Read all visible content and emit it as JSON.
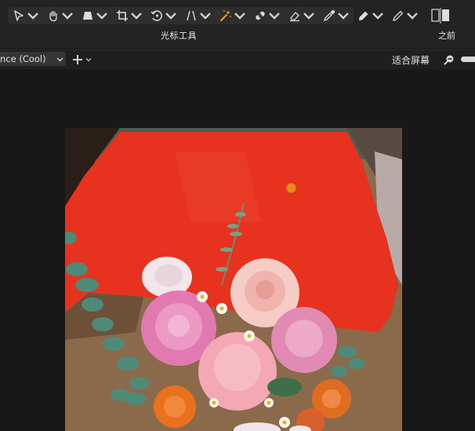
{
  "toolbar": {
    "tools": [
      {
        "icon": "select-arrow-icon",
        "label": ""
      },
      {
        "icon": "hand-icon",
        "label": ""
      },
      {
        "icon": "transform-icon",
        "label": ""
      },
      {
        "icon": "crop-icon",
        "label": ""
      },
      {
        "icon": "rotate-icon",
        "label": ""
      },
      {
        "icon": "perspective-icon",
        "label": ""
      },
      {
        "icon": "magic-wand-icon",
        "label": ""
      },
      {
        "icon": "healing-bandage-icon",
        "label": ""
      },
      {
        "icon": "eraser-icon",
        "label": ""
      },
      {
        "icon": "eyedropper-icon",
        "label": ""
      },
      {
        "icon": "brush-icon",
        "label": ""
      },
      {
        "icon": "pencil-icon",
        "label": ""
      }
    ],
    "caption": "光标工具",
    "before_caption": "之前"
  },
  "subbar": {
    "preset_value": "nce (Cool)",
    "fit_label": "适合屏幕"
  },
  "colors": {
    "toolbar_bg": "#232323",
    "canvas_bg": "#181818",
    "mask_red": "#e6321e",
    "pin": "#e98a1c"
  }
}
